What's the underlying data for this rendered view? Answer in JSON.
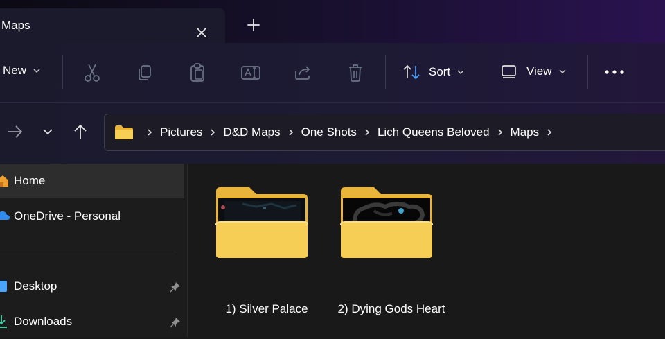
{
  "window": {
    "tab_title": "Maps"
  },
  "toolbar": {
    "new_label": "New",
    "sort_label": "Sort",
    "view_label": "View"
  },
  "address_bar": {
    "crumbs": [
      "Pictures",
      "D&D Maps",
      "One Shots",
      "Lich Queens Beloved",
      "Maps"
    ]
  },
  "sidebar": {
    "items": [
      {
        "label": "Home"
      },
      {
        "label": "OneDrive - Personal"
      },
      {
        "label": "Desktop"
      },
      {
        "label": "Downloads"
      }
    ]
  },
  "folders": [
    {
      "label": "1) Silver Palace"
    },
    {
      "label": "2) Dying Gods Heart"
    }
  ],
  "colors": {
    "folder": "#f4c94a",
    "folder_back": "#e8b53a",
    "selection": "#2d2d2d",
    "accent_blue": "#4aa3ff"
  }
}
